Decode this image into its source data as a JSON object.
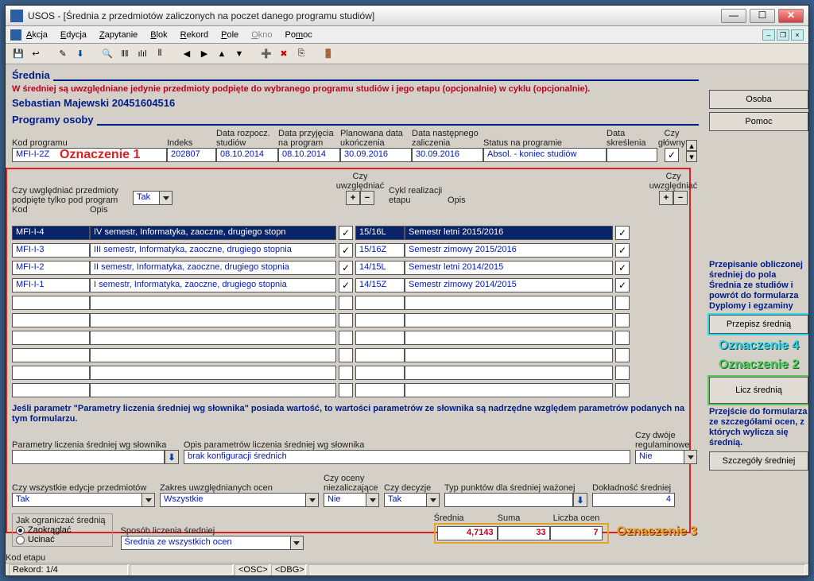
{
  "title": "USOS - [Średnia z przedmiotów zaliczonych na poczet danego programu studiów]",
  "menu": {
    "akcja": "Akcja",
    "edycja": "Edycja",
    "zapytanie": "Zapytanie",
    "blok": "Blok",
    "rekord": "Rekord",
    "pole": "Pole",
    "okno": "Okno",
    "pomoc": "Pomoc"
  },
  "heading1": "Średnia",
  "warning": "W średniej są uwzględniane jedynie przedmioty podpięte do wybranego programu studiów i jego etapu (opcjonalnie) w  cyklu (opcjonalnie).",
  "person": "Sebastian Majewski 20451604516",
  "heading2": "Programy osoby",
  "progcols": {
    "kod": "Kod programu",
    "indeks": "Indeks",
    "rozp": "Data rozpocz. studiów",
    "przyj": "Data przyjęcia na program",
    "plan": "Planowana data ukończenia",
    "nast": "Data następnego zaliczenia",
    "status": "Status na programie",
    "skre": "Data skreślenia",
    "glowny": "Czy główny"
  },
  "progrow": {
    "kod": "MFI-I-2Z",
    "indeks": "202807",
    "rozp": "08.10.2014",
    "przyj": "08.10.2014",
    "plan": "30.09.2016",
    "nast": "30.09.2016",
    "status": "Absol. - koniec studiów",
    "skre": "",
    "glowny": true
  },
  "oznaczenie1": "Oznaczenie 1",
  "filters": {
    "uwzgl_lbl": "Czy uwględniać przedmioty podpięte tylko pod program",
    "uwzgl_val": "Tak",
    "czy_uwzgl": "Czy uwzględniać",
    "cykl_lbl": "Cykl realizacji etapu",
    "opis": "Opis"
  },
  "gridcols": {
    "kod": "Kod",
    "opis": "Opis"
  },
  "rows": [
    {
      "kod": "MFI-I-4",
      "opis": "IV semestr, Informatyka, zaoczne, drugiego stopn",
      "c1": true,
      "cykl": "15/16L",
      "copis": "Semestr letni 2015/2016",
      "c2": true
    },
    {
      "kod": "MFI-I-3",
      "opis": "III semestr, Informatyka, zaoczne, drugiego stopnia",
      "c1": true,
      "cykl": "15/16Z",
      "copis": "Semestr zimowy 2015/2016",
      "c2": true
    },
    {
      "kod": "MFI-I-2",
      "opis": "II semestr, Informatyka, zaoczne, drugiego stopnia",
      "c1": true,
      "cykl": "14/15L",
      "copis": "Semestr letni 2014/2015",
      "c2": true
    },
    {
      "kod": "MFI-I-1",
      "opis": "I semestr, Informatyka, zaoczne, drugiego stopnia",
      "c1": true,
      "cykl": "14/15Z",
      "copis": "Semestr zimowy 2014/2015",
      "c2": true
    }
  ],
  "note2": "Jeśli parametr \"Parametry liczenia średniej wg słownika\" posiada wartość, to wartości parametrów ze słownika są nadrzędne względem parametrów podanych na tym formularzu.",
  "params": {
    "lbl1": "Parametry liczenia średniej wg słownika",
    "lbl2": "Opis parametrów liczenia średniej wg słownika",
    "val2": "brak konfiguracji średnich",
    "lbl3": "Czy dwóje regulaminowe",
    "val3": "Nie"
  },
  "bottom": {
    "edycje_lbl": "Czy wszystkie edycje przedmiotów",
    "edycje_val": "Tak",
    "zakres_lbl": "Zakres uwzględnianych ocen",
    "zakres_val": "Wszystkie",
    "niezal_lbl": "Czy oceny niezaliczające",
    "niezal_val": "Nie",
    "decyzje_lbl": "Czy decyzje",
    "decyzje_val": "Tak",
    "typ_lbl": "Typ punktów dla średniej ważonej",
    "typ_val": "",
    "dokl_lbl": "Dokładność średniej",
    "dokl_val": "4"
  },
  "limit": {
    "lbl": "Jak ograniczać średnią",
    "r1": "Zaokrąglać",
    "r2": "Ucinać",
    "sposob_lbl": "Sposób liczenia średniej",
    "sposob_val": "Średnia ze wszystkich ocen"
  },
  "result": {
    "srednia_lbl": "Średnia",
    "srednia": "4,7143",
    "suma_lbl": "Suma",
    "suma": "33",
    "liczba_lbl": "Liczba ocen",
    "liczba": "7"
  },
  "oznaczenie3": "Oznaczenie 3",
  "side": {
    "osoba": "Osoba",
    "pomoc": "Pomoc",
    "info1": "Przepisanie obliczonej średniej do pola Średnia ze studiów i powrót do formularza Dyplomy i egzaminy",
    "btn1": "Przepisz średnią",
    "ozn4": "Oznaczenie 4",
    "ozn2": "Oznaczenie 2",
    "btn2": "Licz średnią",
    "info2": "Przejście do formularza ze szczegółami ocen, z których wylicza się średnią.",
    "btn3": "Szczegóły średniej"
  },
  "status": {
    "etap": "Kod etapu",
    "rekord": "Rekord: 1/4",
    "osc": "<OSC>",
    "dbg": "<DBG>"
  }
}
